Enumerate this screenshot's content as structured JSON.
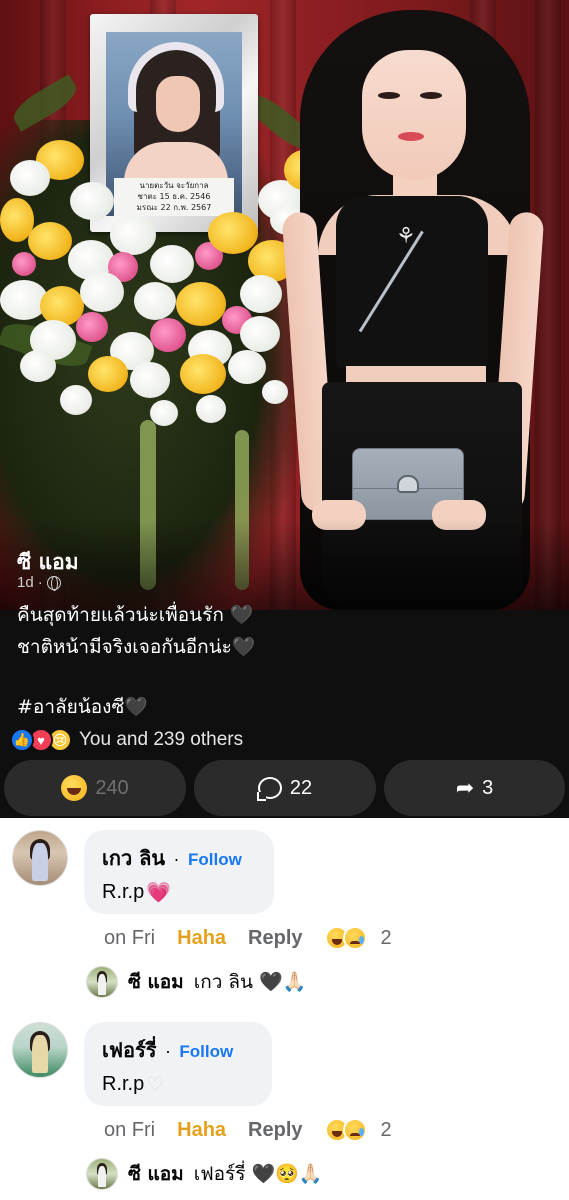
{
  "post": {
    "photo": {
      "frame_label_line1": "นายตะวัน จะวัยกาล",
      "frame_label_line2": "ชาตะ 15 ธ.ค. 2546",
      "frame_label_line3": "มรณะ 22 ก.พ. 2567"
    },
    "author": "ซี แอม",
    "time": "1d",
    "audience_icon": "globe-icon",
    "caption": {
      "line1": "คืนสุดท้ายแล้วน่ะเพื่อนรัก 🖤",
      "line2": "ชาติหน้ามีจริงเจอกันอีกน่ะ🖤",
      "hashtag": "#อาลัยน้องซี🖤"
    },
    "reactions": {
      "icons": [
        "like-icon",
        "love-icon",
        "sad-icon"
      ],
      "summary": "You and 239 others"
    },
    "actions": {
      "react_count": "240",
      "comment_count": "22",
      "share_count": "3"
    },
    "colors": {
      "dark_bg": "#0f0f0f",
      "button_bg": "#2b2b2b",
      "facebook_blue": "#1877f2",
      "haha_color": "#e6a11c"
    }
  },
  "comments": [
    {
      "name": "เกว ลิน",
      "follow": "Follow",
      "text": "R.r.p",
      "time": "on Fri",
      "reaction_label": "Haha",
      "reply_label": "Reply",
      "react_count": "2",
      "reply": {
        "name": "ซี แอม",
        "text": "เกว ลิน 🖤🙏🏻"
      }
    },
    {
      "name": "เฟอร์รี่",
      "follow": "Follow",
      "text": "R.r.p",
      "time": "on Fri",
      "reaction_label": "Haha",
      "reply_label": "Reply",
      "react_count": "2",
      "reply": {
        "name": "ซี แอม",
        "text": "เฟอร์รี่ 🖤🥺🙏🏻"
      }
    }
  ]
}
